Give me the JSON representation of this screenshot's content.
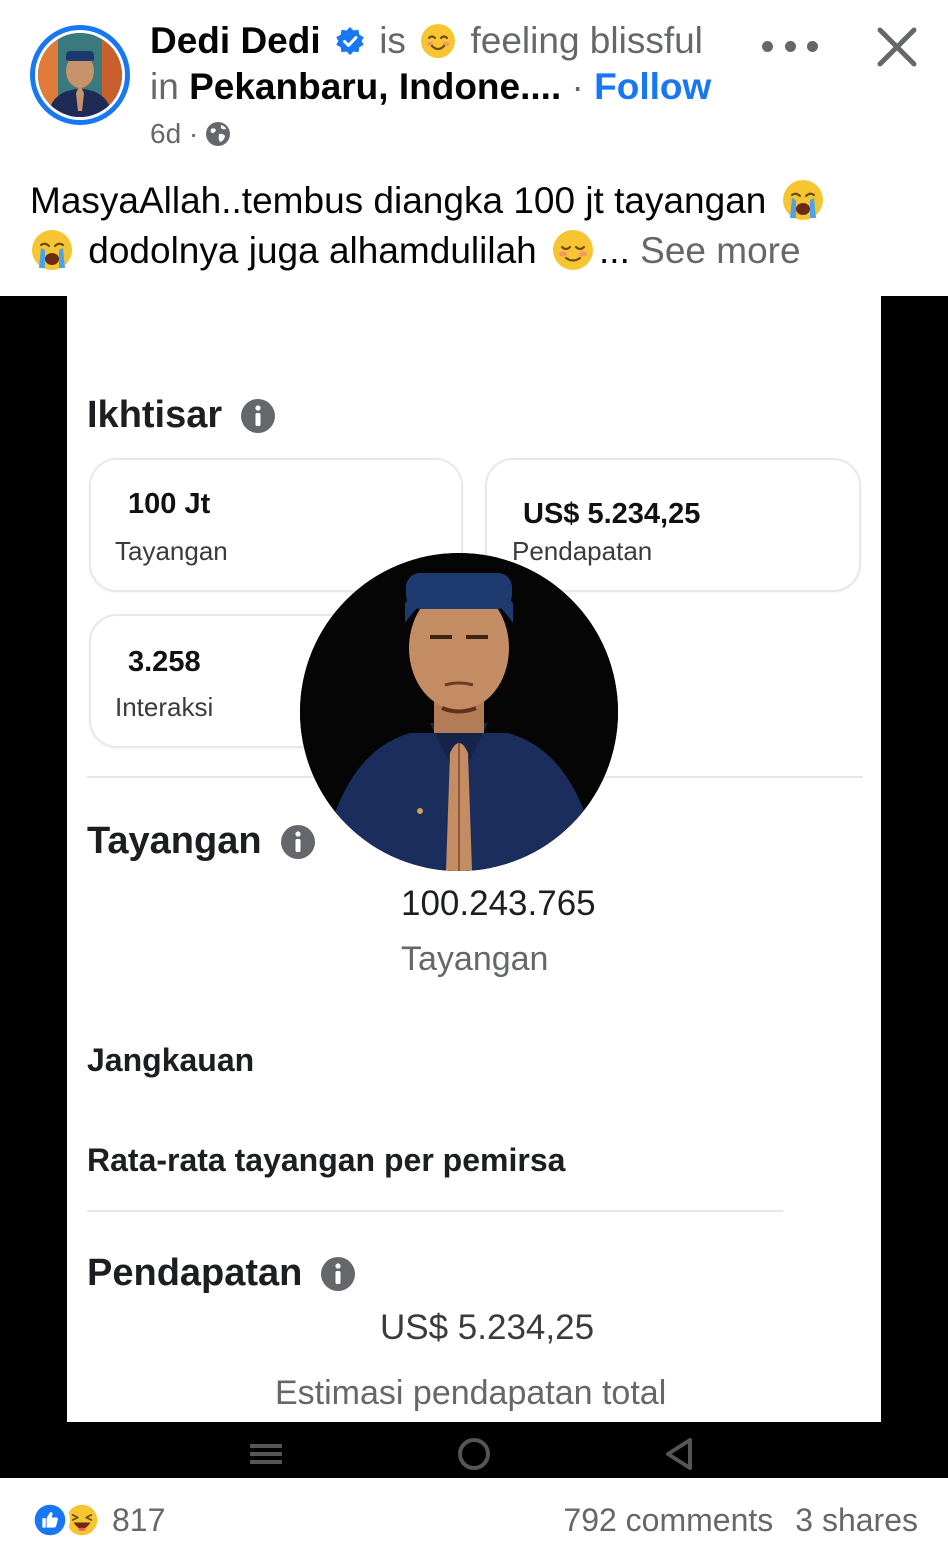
{
  "post": {
    "author": "Dedi Dedi",
    "is_text": "is",
    "feeling_text": "feeling blissful",
    "in_text": "in",
    "location": "Pekanbaru, Indone....",
    "dot": "·",
    "follow_label": "Follow",
    "time": "6d ·",
    "text_line1": "MasyaAllah..tembus diangka 100 jt tayangan",
    "text_line2": "dodolnya juga alhamdulilah",
    "ellipsis": "...",
    "see_more": "See more"
  },
  "insights": {
    "overview_title": "Ikhtisar",
    "cards": [
      {
        "value": "100 Jt",
        "label": "Tayangan"
      },
      {
        "value": "US$ 5.234,25",
        "label": "Pendapatan"
      },
      {
        "value": "3.258",
        "label": "Interaksi"
      }
    ],
    "views_title": "Tayangan",
    "views_value": "100.243.765",
    "views_label": "Tayangan",
    "reach_label": "Jangkauan",
    "avg_label": "Rata-rata tayangan per pemirsa",
    "earnings_title": "Pendapatan",
    "earnings_value": "US$ 5.234,25",
    "earnings_label": "Estimasi pendapatan total"
  },
  "footer": {
    "reaction_count": "817",
    "comments": "792 comments",
    "shares": "3 shares"
  },
  "colors": {
    "brand_blue": "#1877f2",
    "muted_gray": "#65676b",
    "media_background": "#000000"
  }
}
